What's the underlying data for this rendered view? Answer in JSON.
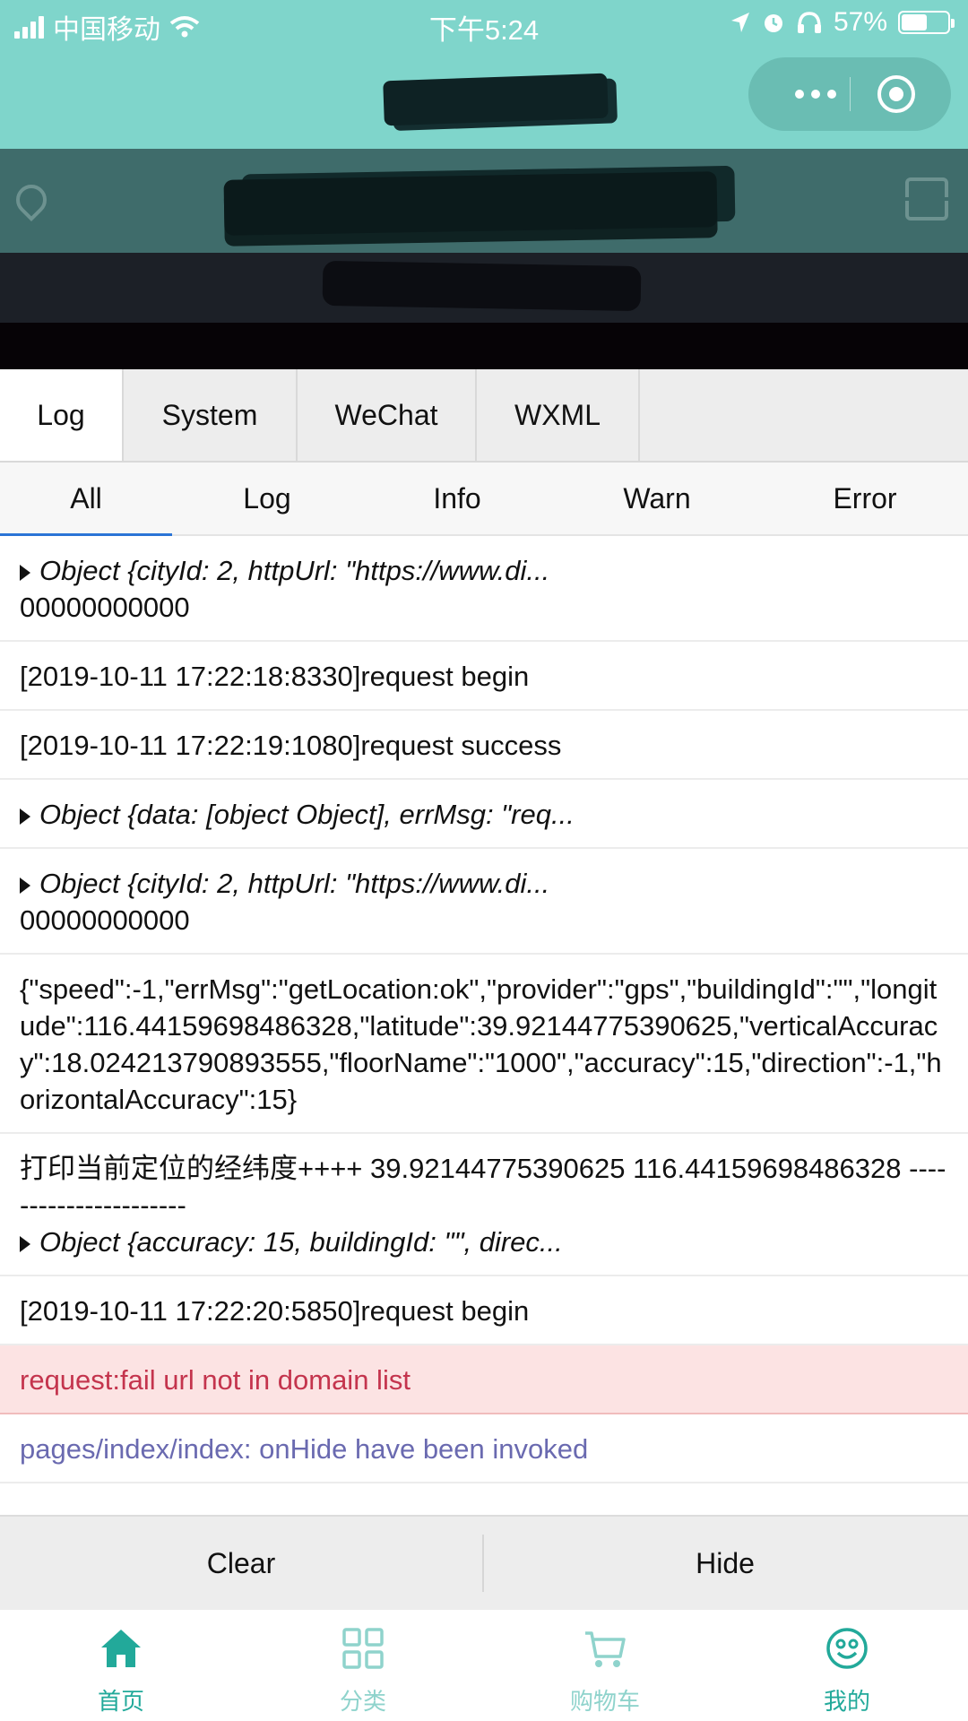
{
  "status_bar": {
    "carrier": "中国移动",
    "time": "下午5:24",
    "battery": "57%",
    "battery_level": 0.57
  },
  "colors": {
    "brand": "#7fd5cb",
    "tab_active": "#22a99a",
    "tab_inactive": "#8fd3cc",
    "error_text": "#c4344d",
    "error_bg": "#fce3e3",
    "info_text": "#6a6ab0"
  },
  "console": {
    "tabs": [
      {
        "label": "Log"
      },
      {
        "label": "System"
      },
      {
        "label": "WeChat"
      },
      {
        "label": "WXML"
      }
    ],
    "active_tab": "Log",
    "filters": [
      {
        "label": "All"
      },
      {
        "label": "Log"
      },
      {
        "label": "Info"
      },
      {
        "label": "Warn"
      },
      {
        "label": "Error"
      }
    ],
    "active_filter": "All",
    "logs": [
      {
        "type": "object",
        "text": "Object {cityId: 2, httpUrl: \"https://www.di...",
        "extra": "00000000000"
      },
      {
        "type": "log",
        "text": "[2019-10-11 17:22:18:8330]request begin"
      },
      {
        "type": "log",
        "text": "[2019-10-11 17:22:19:1080]request success"
      },
      {
        "type": "object",
        "text": "Object {data: [object Object], errMsg: \"req..."
      },
      {
        "type": "object",
        "text": "Object {cityId: 2, httpUrl: \"https://www.di...",
        "extra": "00000000000"
      },
      {
        "type": "log",
        "text": "{\"speed\":-1,\"errMsg\":\"getLocation:ok\",\"provider\":\"gps\",\"buildingId\":\"\",\"longitude\":116.44159698486328,\"latitude\":39.92144775390625,\"verticalAccuracy\":18.024213790893555,\"floorName\":\"1000\",\"accuracy\":15,\"direction\":-1,\"horizontalAccuracy\":15}"
      },
      {
        "type": "mixed",
        "text": "打印当前定位的经纬度++++ 39.92144775390625 116.44159698486328 ----------------------",
        "object": "Object {accuracy: 15, buildingId: \"\", direc..."
      },
      {
        "type": "log",
        "text": "[2019-10-11 17:22:20:5850]request begin"
      },
      {
        "type": "error",
        "text": "request:fail url not in domain list"
      },
      {
        "type": "info",
        "text": "pages/index/index: onHide have been invoked"
      }
    ],
    "buttons": {
      "clear": "Clear",
      "hide": "Hide"
    }
  },
  "tabbar": {
    "items": [
      {
        "label": "首页",
        "icon": "home-icon",
        "active": true
      },
      {
        "label": "分类",
        "icon": "grid-icon",
        "active": false
      },
      {
        "label": "购物车",
        "icon": "cart-icon",
        "active": false
      },
      {
        "label": "我的",
        "icon": "smiley-icon",
        "active": false
      }
    ]
  }
}
